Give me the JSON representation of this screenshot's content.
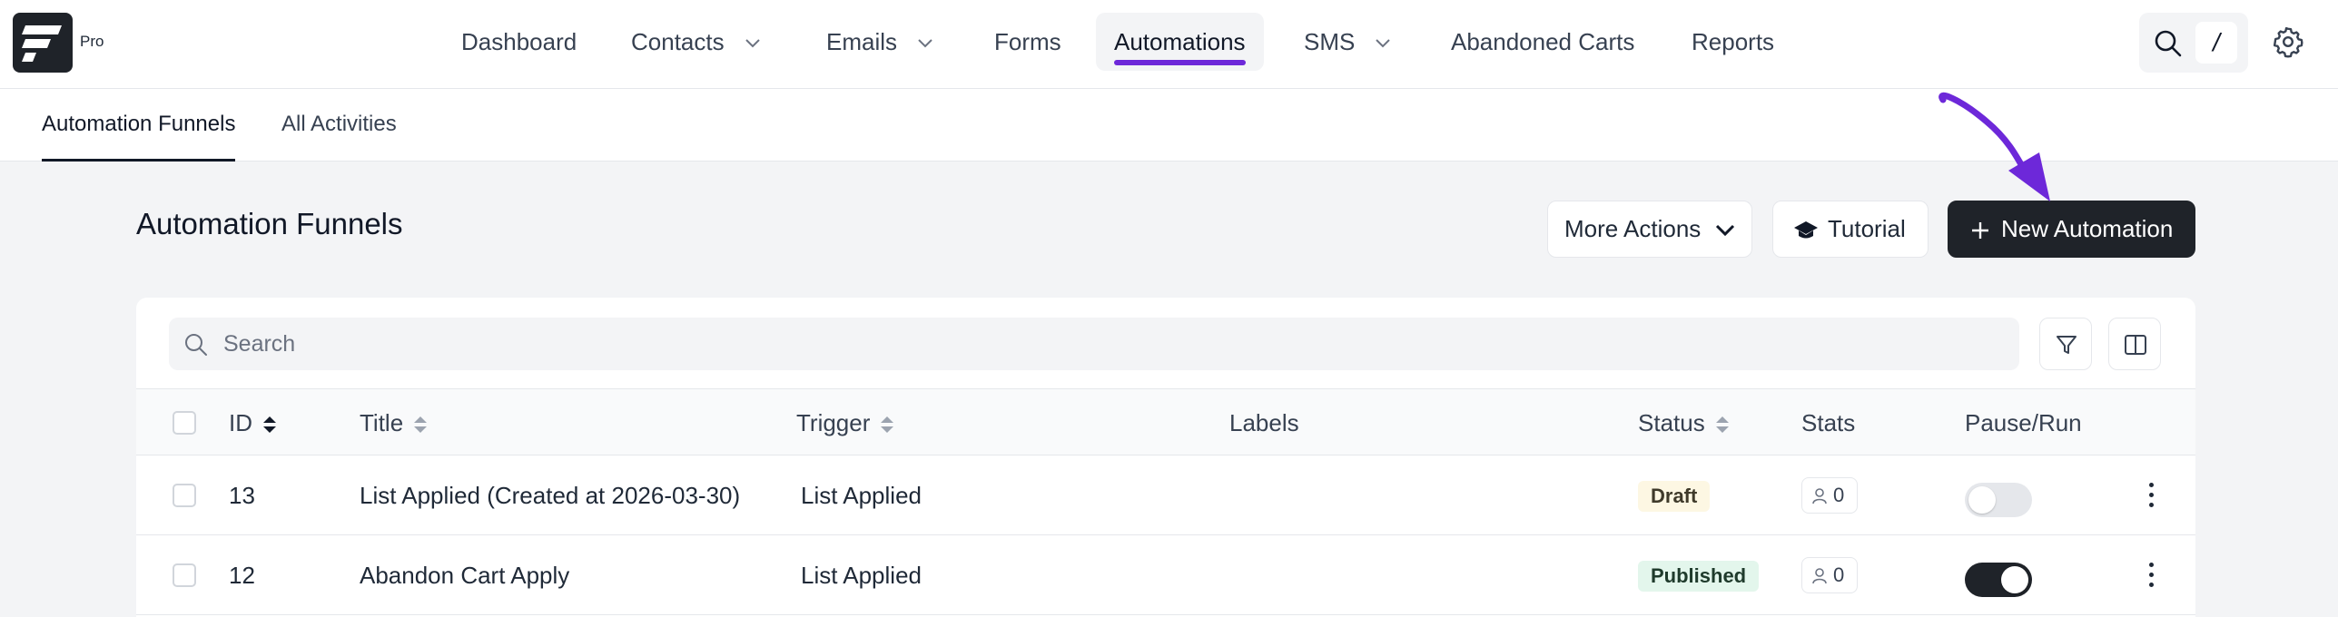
{
  "brand": {
    "badge": "Pro"
  },
  "nav": {
    "items": [
      {
        "label": "Dashboard",
        "has_menu": false
      },
      {
        "label": "Contacts",
        "has_menu": true
      },
      {
        "label": "Emails",
        "has_menu": true
      },
      {
        "label": "Forms",
        "has_menu": false
      },
      {
        "label": "Automations",
        "has_menu": false,
        "active": true
      },
      {
        "label": "SMS",
        "has_menu": true
      },
      {
        "label": "Abandoned Carts",
        "has_menu": false
      },
      {
        "label": "Reports",
        "has_menu": false
      }
    ],
    "search_shortcut": "/"
  },
  "subnav": {
    "tabs": [
      {
        "label": "Automation Funnels",
        "active": true
      },
      {
        "label": "All Activities",
        "active": false
      }
    ]
  },
  "page": {
    "title": "Automation Funnels",
    "more_actions_label": "More Actions",
    "tutorial_label": "Tutorial",
    "new_automation_label": "New Automation"
  },
  "table": {
    "search_placeholder": "Search",
    "columns": {
      "id": "ID",
      "title": "Title",
      "trigger": "Trigger",
      "labels": "Labels",
      "status": "Status",
      "stats": "Stats",
      "pause_run": "Pause/Run"
    },
    "rows": [
      {
        "id": "13",
        "title": "List Applied (Created at 2026-03-30)",
        "trigger": "List Applied",
        "labels": "",
        "status": "Draft",
        "stats": "0",
        "running": false
      },
      {
        "id": "12",
        "title": "Abandon Cart Apply",
        "trigger": "List Applied",
        "labels": "",
        "status": "Published",
        "stats": "0",
        "running": true
      }
    ]
  },
  "colors": {
    "accent": "#6d28d9",
    "dark_button": "#1f2329",
    "draft_badge_bg": "#fdf7e3",
    "published_badge_bg": "#e3f6ec"
  }
}
